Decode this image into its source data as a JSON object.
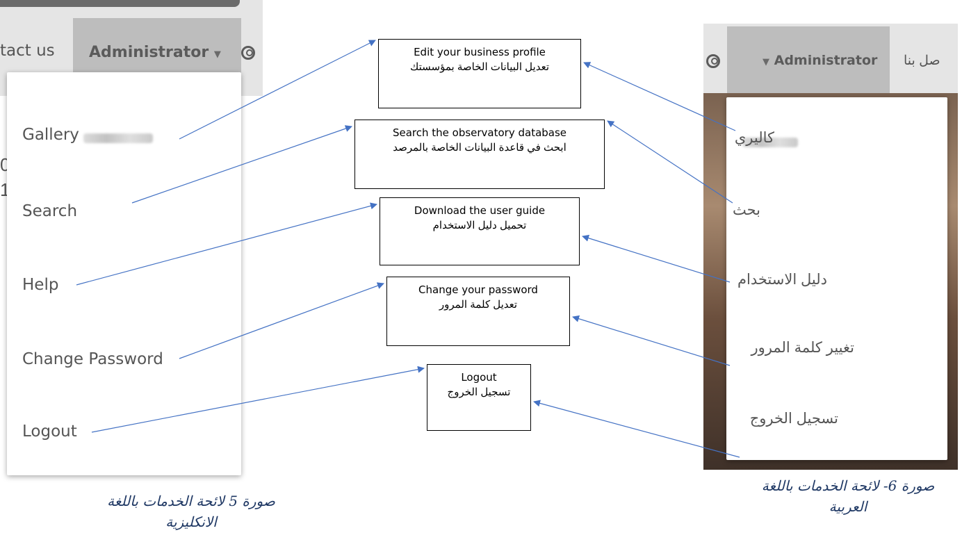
{
  "left_screenshot": {
    "contact_partial": "tact us",
    "admin_label": "Administrator",
    "menu_items": [
      "Gallery",
      "Search",
      "Help",
      "Change Password",
      "Logout"
    ],
    "caption": "صورة 5 لائحة الخدمات باللغة الانكليزية"
  },
  "right_screenshot": {
    "contact_partial": "صل بنا",
    "admin_label": "Administrator",
    "menu_items": [
      "كاليري",
      "بحث",
      "دليل الاستخدام",
      "تغيير كلمة المرور",
      "تسجيل الخروج"
    ],
    "caption": "صورة 6- لائحة الخدمات باللغة العربية"
  },
  "callouts": [
    {
      "en": "Edit your business profile",
      "ar": "تعديل البيانات الخاصة بمؤسستك"
    },
    {
      "en": "Search the observatory database",
      "ar": "ابحث في قاعدة البيانات الخاصة بالمرصد"
    },
    {
      "en": "Download the user guide",
      "ar": "تحميل دليل الاستخدام"
    },
    {
      "en": "Change your password",
      "ar": "تعديل كلمة المرور"
    },
    {
      "en": "Logout",
      "ar": "تسجيل الخروج"
    }
  ],
  "colors": {
    "arrow": "#4472c4",
    "caption": "#1f3864",
    "admin_highlight": "#bdbdbd",
    "topbar": "#e5e5e5",
    "menu_text": "#555555"
  },
  "icons": [
    "user-circle-icon",
    "caret-down-icon"
  ]
}
